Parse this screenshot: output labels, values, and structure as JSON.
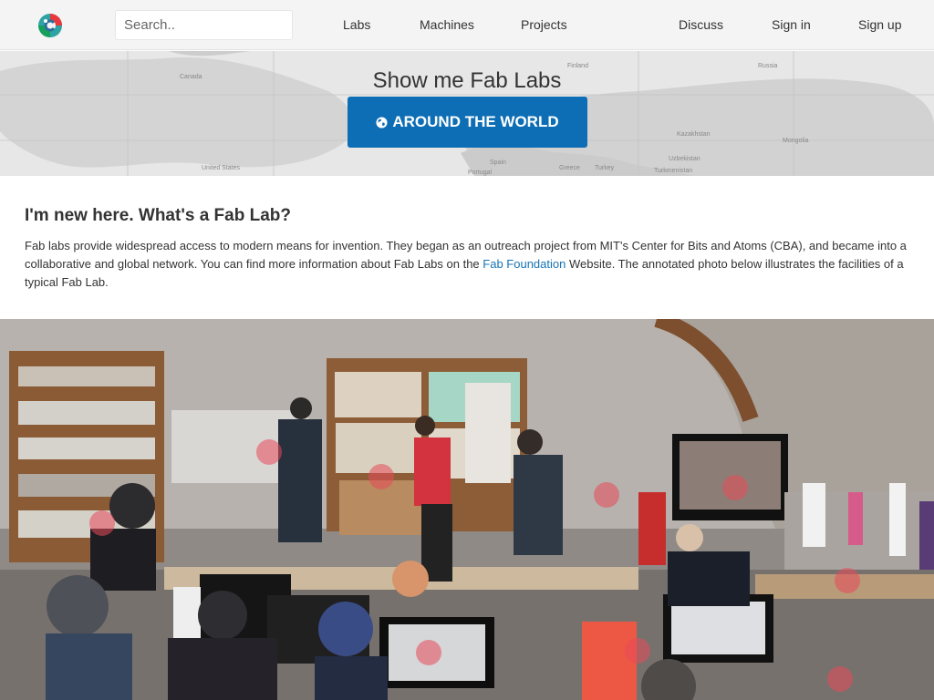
{
  "nav": {
    "logo_icon": "fab-lab-logo",
    "search_placeholder": "Search..",
    "links": [
      "Labs",
      "Machines",
      "Projects"
    ],
    "right_links": [
      "Discuss",
      "Sign in",
      "Sign up"
    ]
  },
  "hero": {
    "title": "Show me Fab Labs",
    "button_label": "AROUND THE WORLD",
    "button_icon": "globe-icon",
    "accent": "#0d6eb5",
    "map_labels": [
      "Canada",
      "Finland",
      "Russia",
      "Kazakhstan",
      "Mongolia",
      "Uzbekistan",
      "Turkmenistan",
      "United States",
      "Spain",
      "Greece",
      "Turkey",
      "Portugal"
    ]
  },
  "intro": {
    "heading": "I'm new here. What's a Fab Lab?",
    "text_before_link": "Fab labs provide widespread access to modern means for invention. They began as an outreach project from MIT's Center for Bits and Atoms (CBA), and became into a collaborative and global network. You can find more information about Fab Labs on the ",
    "link_text": "Fab Foundation",
    "text_after_link": " Website. The annotated photo below illustrates the facilities of a typical Fab Lab."
  },
  "photo": {
    "description_icon": "annotated-fab-lab-photo",
    "hotspot_color": "#e84a5a"
  }
}
